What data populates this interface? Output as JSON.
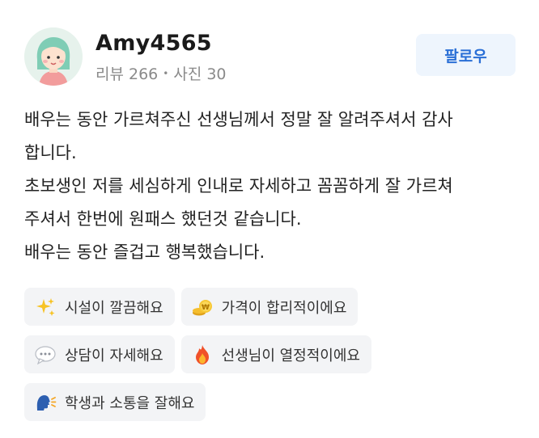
{
  "profile": {
    "username": "Amy4565",
    "reviews": "리뷰 266",
    "separator": "•",
    "photos": "사진 30",
    "follow_label": "팔로우"
  },
  "review": {
    "lines": [
      "배우는 동안 가르쳐주신 선생님께서 정말 잘 알려주셔서 감사",
      "합니다.",
      "초보생인 저를 세심하게 인내로 자세하고 꼼꼼하게 잘 가르쳐",
      "주셔서 한번에 원패스 했던것 같습니다.",
      "배우는 동안 즐겁고 행복했습니다."
    ]
  },
  "tags": [
    {
      "icon": "sparkles-icon",
      "label": "시설이 깔끔해요"
    },
    {
      "icon": "coins-icon",
      "label": "가격이 합리적이에요"
    },
    {
      "icon": "speech-bubble-icon",
      "label": "상담이 자세해요"
    },
    {
      "icon": "fire-icon",
      "label": "선생님이 열정적이에요"
    },
    {
      "icon": "speaking-head-icon",
      "label": "학생과 소통을 잘해요"
    }
  ]
}
